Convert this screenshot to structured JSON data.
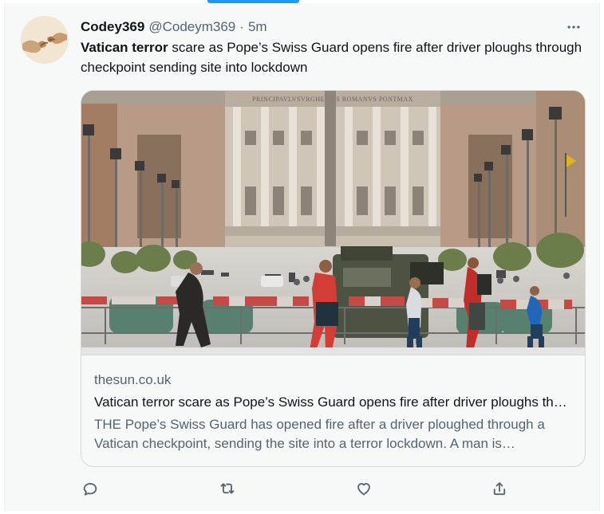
{
  "tweet": {
    "author": {
      "display_name": "Codey369",
      "handle": "@Codeym369",
      "separator": "·",
      "time": "5m"
    },
    "text": {
      "bold": "Vatican terror",
      "rest": " scare as Pope’s Swiss Guard opens fire after driver ploughs through checkpoint sending site into lockdown"
    },
    "card": {
      "domain": "thesun.co.uk",
      "title": "Vatican terror scare as Pope’s Swiss Guard opens fire after driver ploughs through checkpoint sending site into lockdown",
      "description": "THE Pope’s Swiss Guard has opened fire after a driver ploughed through a Vatican checkpoint, sending the site into a terror lockdown. A man is understood to have driven up to the Vatican and ignored orders to stop."
    },
    "actions": [
      "reply-icon",
      "retweet-icon",
      "like-icon",
      "share-icon"
    ]
  },
  "colors": {
    "accent": "#1d9bf0",
    "text_primary": "#0f1419",
    "text_secondary": "#536471",
    "border": "#cfd9de",
    "background": "#f7f9f9"
  },
  "image": {
    "entablature_inscription": "PRINCIPAVLVSVRGHESIVS ROMANVS PONTMAX"
  }
}
